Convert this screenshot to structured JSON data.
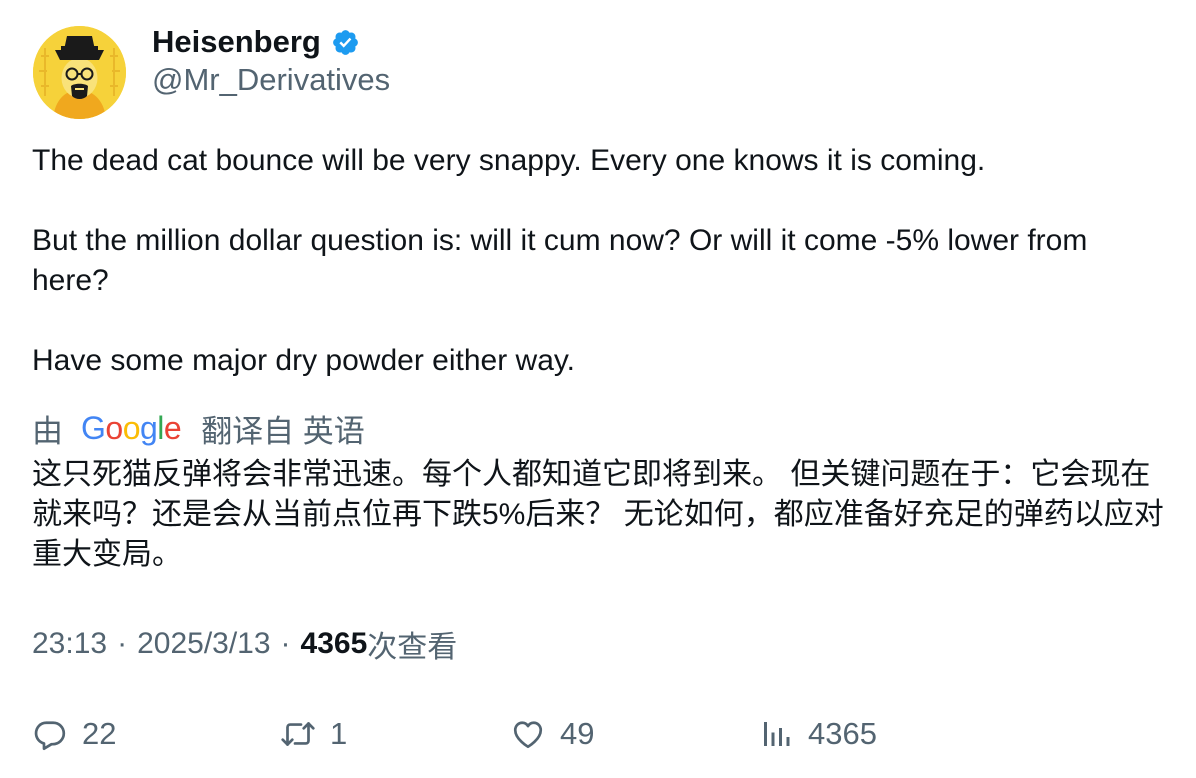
{
  "author": {
    "display_name": "Heisenberg",
    "handle": "@Mr_Derivatives",
    "verified": true,
    "verified_color": "#1d9bf0"
  },
  "tweet": {
    "paragraphs": [
      "The dead cat bounce will be very snappy. Every one knows it is coming.",
      "But the million dollar question is: will it cum now? Or will it come -5% lower from here?",
      "Have some major dry powder either way."
    ]
  },
  "translation": {
    "prefix": "由",
    "provider_logo": "Google",
    "suffix": "翻译自 英语",
    "text": "这只死猫反弹将会非常迅速。每个人都知道它即将到来。 但关键问题在于：它会现在就来吗？还是会从当前点位再下跌5%后来？ 无论如何，都应准备好充足的弹药以应对重大变局。"
  },
  "meta": {
    "time": "23:13",
    "separator": "·",
    "date": "2025/3/13",
    "views_count": "4365",
    "views_label": "次查看"
  },
  "actions": {
    "replies": "22",
    "retweets": "1",
    "likes": "49",
    "views": "4365"
  },
  "icons": {
    "reply": "reply-icon",
    "retweet": "retweet-icon",
    "like": "heart-icon",
    "views": "bar-chart-icon",
    "verified": "verified-badge-icon"
  },
  "colors": {
    "text_primary": "#0f1419",
    "text_secondary": "#536471",
    "accent": "#1d9bf0",
    "google_blue": "#4285f4",
    "google_red": "#ea4335",
    "google_yellow": "#fbbc05",
    "google_green": "#34a853"
  }
}
